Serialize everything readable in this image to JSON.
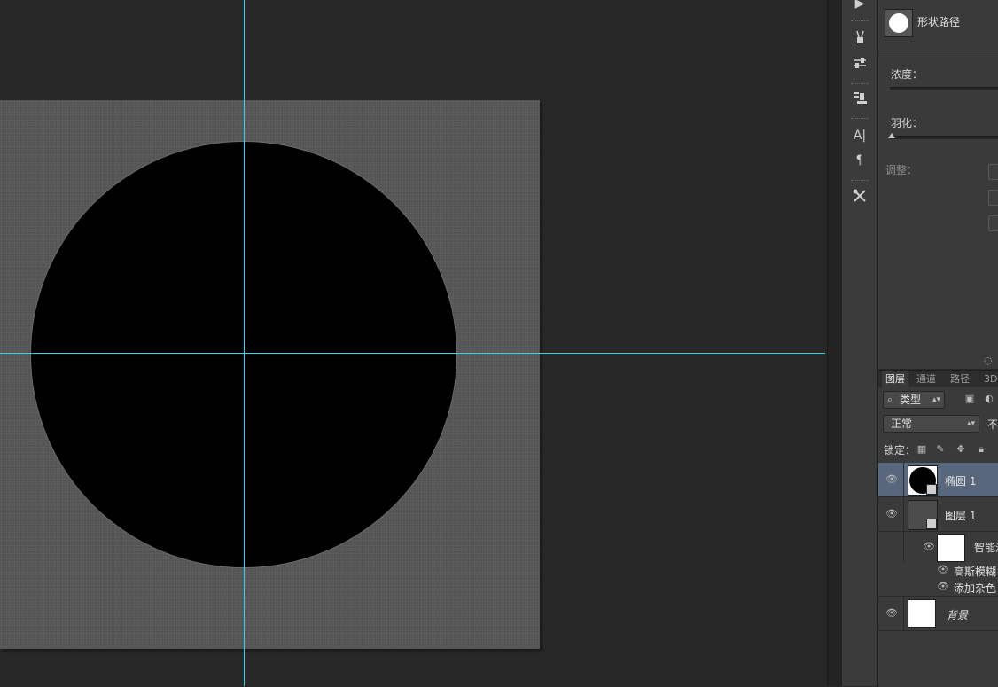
{
  "properties": {
    "shape_label": "形状路径",
    "density_label": "浓度：",
    "feather_label": "羽化：",
    "adjust_label": "调整：",
    "footer_icon": "dotted-selection-icon"
  },
  "tool_strip": {
    "icons": [
      "play-icon",
      "brush-presets-icon",
      "tool-presets-icon",
      "clone-source-icon",
      "character-icon",
      "paragraph-icon",
      "tools-icon"
    ],
    "glyphs": {
      "character": "A|",
      "paragraph": "¶"
    }
  },
  "layers_panel": {
    "tabs": [
      {
        "label": "图层",
        "active": true
      },
      {
        "label": "通道",
        "active": false
      },
      {
        "label": "路径",
        "active": false
      },
      {
        "label": "3D",
        "active": false
      }
    ],
    "filter": {
      "label": "类型",
      "glyph": "⌕"
    },
    "blend_mode": "正常",
    "opacity_label_partial": "不",
    "lock_label": "锁定：",
    "layers": [
      {
        "name": "椭圆 1",
        "selected": true,
        "thumb": "black-circle"
      },
      {
        "name": "图层 1",
        "selected": false,
        "thumb": "smart-object"
      },
      {
        "name": "智能滤",
        "selected": false,
        "thumb": "white-mask"
      },
      {
        "name": "高斯模糊",
        "selected": false,
        "thumb": "none"
      },
      {
        "name": "添加杂色",
        "selected": false,
        "thumb": "none"
      },
      {
        "name": "背景",
        "selected": false,
        "thumb": "white"
      }
    ]
  },
  "colors": {
    "guide": "#33d6dc",
    "canvas_bg": "#555555",
    "ellipse_fill": "#000000",
    "selected_layer": "#58677b"
  }
}
